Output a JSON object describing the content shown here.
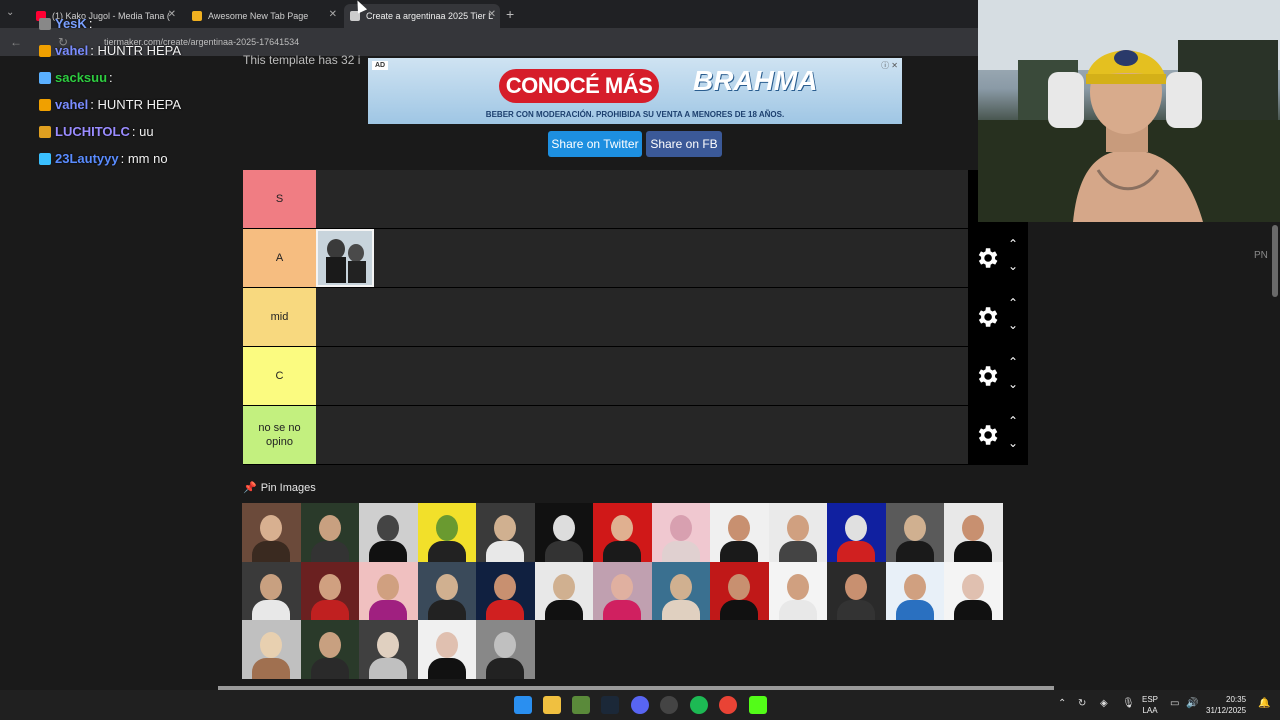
{
  "browser": {
    "tabs": [
      {
        "title": "(1) Kako Jugol - Media Tana (",
        "favicon_color": "#ff0033"
      },
      {
        "title": "Awesome New Tab Page",
        "favicon_color": "#f0b020"
      },
      {
        "title": "Create a argentinaa 2025 Tier L",
        "favicon_color": "#cccccc"
      }
    ],
    "url": "tiermaker.com/create/argentinaa-2025-17641534"
  },
  "page": {
    "template_text": "This template has 32 i",
    "ad": {
      "tag": "AD",
      "cta": "CONOCÉ MÁS",
      "brand": "BRAHMA",
      "legal": "BEBER CON MODERACIÓN. PROHIBIDA SU VENTA A MENORES DE 18 AÑOS."
    },
    "share_twitter": "Share on Twitter",
    "share_fb": "Share on FB",
    "tiers": [
      {
        "label": "S",
        "color": "#f07d83",
        "items": 0
      },
      {
        "label": "A",
        "color": "#f6bd80",
        "items": 1
      },
      {
        "label": "mid",
        "color": "#f8d97f",
        "items": 0
      },
      {
        "label": "C",
        "color": "#fbfb80",
        "items": 0
      },
      {
        "label": "no se no opino",
        "color": "#c3f07f",
        "items": 0
      }
    ],
    "pin_images_label": "Pin Images",
    "side_label": "PN"
  },
  "chat": [
    {
      "user": "YesK",
      "user_color": "#7aa0ff",
      "msg": "",
      "badge_color": "#888888"
    },
    {
      "user": "vahel",
      "user_color": "#7a8cff",
      "msg": "HUNTR  HEPA",
      "badge_color": "#f0a000"
    },
    {
      "user": "sacksuu",
      "user_color": "#2ecc40",
      "msg": "",
      "badge_color": "#5ab0ff"
    },
    {
      "user": "vahel",
      "user_color": "#7a8cff",
      "msg": "HUNTR  HEPA",
      "badge_color": "#f0a000"
    },
    {
      "user": "LUCHITOLC",
      "user_color": "#9a8cff",
      "msg": "uu",
      "badge_color": "#e0a020"
    },
    {
      "user": "23Lautyyy",
      "user_color": "#5a8cff",
      "msg": "mm no",
      "badge_color": "#3ac0ff"
    }
  ],
  "taskbar": {
    "lang_top": "ESP",
    "lang_bottom": "LAA",
    "time": "20:35",
    "date": "31/12/2025"
  },
  "pool_colors": [
    [
      "#6b4a3a",
      "#d8b090",
      "#3a2a20"
    ],
    [
      "#2a3a2a",
      "#c8a080",
      "#333333"
    ],
    [
      "#cfcfcf",
      "#444444",
      "#111111"
    ],
    [
      "#f2e02a",
      "#6a9a30",
      "#222222"
    ],
    [
      "#3a3a3a",
      "#d0b090",
      "#e8e8e8"
    ],
    [
      "#111111",
      "#dddddd",
      "#333333"
    ],
    [
      "#d01818",
      "#e0b090",
      "#1a1a1a"
    ],
    [
      "#f0c8d0",
      "#d8a0b0",
      "#e0d0d0"
    ],
    [
      "#f0f0f0",
      "#c89070",
      "#1a1a1a"
    ],
    [
      "#eaeaea",
      "#d0a080",
      "#444444"
    ],
    [
      "#1020a0",
      "#e0e0e0",
      "#d02020"
    ],
    [
      "#5a5a5a",
      "#d0b090",
      "#1a1a1a"
    ],
    [
      "#e8e8e8",
      "#c89070",
      "#111111"
    ],
    [
      "#3a3a3a",
      "#c8a080",
      "#e8e8e8"
    ],
    [
      "#6a2020",
      "#d0a080",
      "#c02020"
    ],
    [
      "#f0c0c0",
      "#d0a080",
      "#a02080"
    ],
    [
      "#3a4a5a",
      "#d0b090",
      "#222222"
    ],
    [
      "#102040",
      "#c89070",
      "#d02020"
    ],
    [
      "#e8e8e8",
      "#d0b090",
      "#111111"
    ],
    [
      "#c0a0b0",
      "#e0b0a0",
      "#d02060"
    ],
    [
      "#3a7090",
      "#d0b090",
      "#e0d0c0"
    ],
    [
      "#c01818",
      "#c89070",
      "#111111"
    ],
    [
      "#f4f4f4",
      "#d0a080",
      "#e8e8e8"
    ],
    [
      "#2a2a2a",
      "#c89070",
      "#333333"
    ],
    [
      "#e8f0f8",
      "#d0a080",
      "#2a70c0"
    ],
    [
      "#f4f4f4",
      "#e0c0b0",
      "#111111"
    ],
    [
      "#c0c0c0",
      "#e8d0b0",
      "#a07050"
    ],
    [
      "#2a3a2a",
      "#c8a080",
      "#2a2a2a"
    ],
    [
      "#404040",
      "#e0d0c0",
      "#c0c0c0"
    ],
    [
      "#f0f0f0",
      "#e0c0b0",
      "#111111"
    ],
    [
      "#888888",
      "#c0c0c0",
      "#222222"
    ]
  ]
}
